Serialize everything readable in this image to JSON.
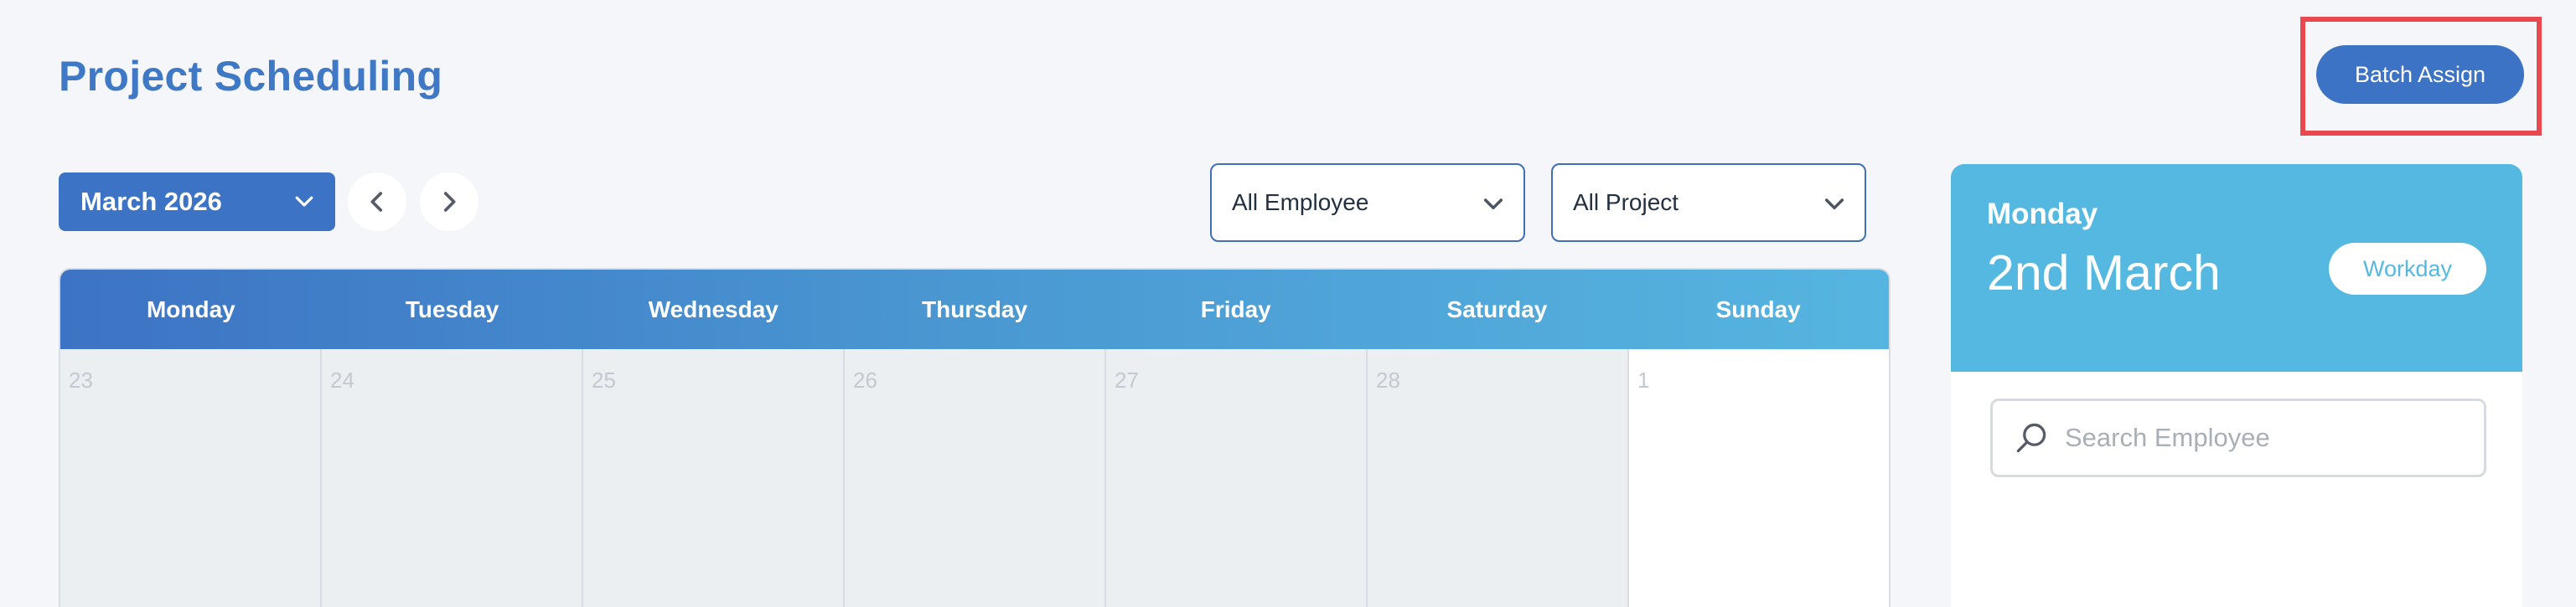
{
  "header": {
    "title": "Project Scheduling",
    "batch_assign_label": "Batch Assign",
    "highlight_color": "#e8484e"
  },
  "toolbar": {
    "month_label": "March 2026",
    "prev_icon": "chevron-left-icon",
    "next_icon": "chevron-right-icon",
    "employee_filter": "All Employee",
    "project_filter": "All Project"
  },
  "calendar": {
    "weekdays": [
      "Monday",
      "Tuesday",
      "Wednesday",
      "Thursday",
      "Friday",
      "Saturday",
      "Sunday"
    ],
    "rows": [
      [
        {
          "day": "23",
          "current_month": false
        },
        {
          "day": "24",
          "current_month": false
        },
        {
          "day": "25",
          "current_month": false
        },
        {
          "day": "26",
          "current_month": false
        },
        {
          "day": "27",
          "current_month": false
        },
        {
          "day": "28",
          "current_month": false
        },
        {
          "day": "1",
          "current_month": true
        }
      ]
    ]
  },
  "side_panel": {
    "weekday": "Monday",
    "date": "2nd March",
    "status_label": "Workday",
    "search_placeholder": "Search Employee",
    "search_icon": "search-icon"
  },
  "colors": {
    "primary": "#3d73c4",
    "accent_light": "#55b8e0",
    "background": "#f5f6fa"
  }
}
